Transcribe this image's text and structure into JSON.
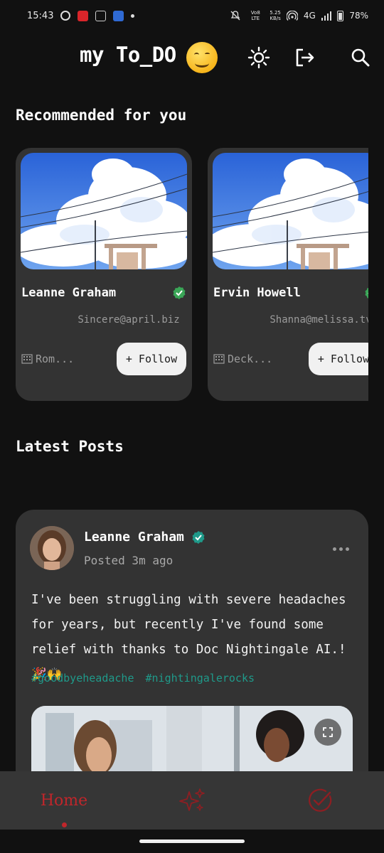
{
  "status_bar": {
    "time": "15:43",
    "net_label": "Vo8 LTE",
    "speed_value": "5.25",
    "speed_unit": "KB/s",
    "network": "4G",
    "battery": "78%"
  },
  "header": {
    "title": "my To_DO",
    "icons": [
      "smile-emoji",
      "sun-icon",
      "logout-icon",
      "search-icon"
    ]
  },
  "recommended": {
    "title": "Recommended for you",
    "users": [
      {
        "name": "Leanne Graham",
        "email": "Sincere@april.biz",
        "company": "Rom...",
        "follow_label": "+ Follow"
      },
      {
        "name": "Ervin Howell",
        "email": "Shanna@melissa.tv",
        "company": "Deck...",
        "follow_label": "+ Follow"
      }
    ]
  },
  "latest_posts": {
    "title": "Latest Posts",
    "posts": [
      {
        "author": "Leanne Graham",
        "time": "Posted 3m ago",
        "body": "I've been struggling with severe headaches for years, but recently I've found some relief with thanks to Doc Nightingale AI.! 🎉🙌",
        "tags": [
          "#goodbyeheadache",
          "#nightingalerocks"
        ]
      }
    ]
  },
  "bottom_nav": {
    "home_label": "Home",
    "items": [
      "home",
      "sparkles-icon",
      "check-circle-icon"
    ],
    "active_color": "#c0262b"
  },
  "colors": {
    "background": "#111111",
    "card": "#333333",
    "accent_red": "#c0262b",
    "tag_teal": "#1f9a8a",
    "verified_green": "#3aa657"
  }
}
